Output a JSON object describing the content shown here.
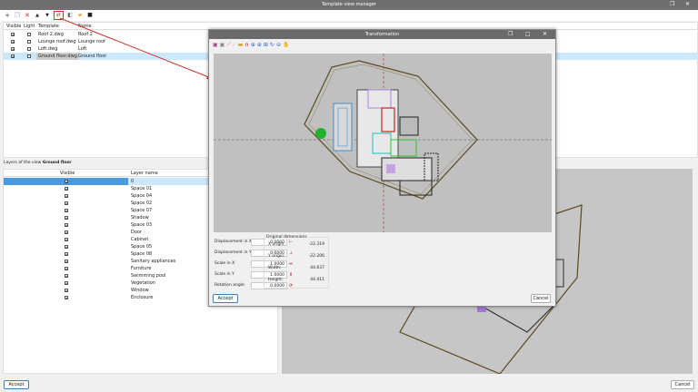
{
  "window": {
    "title": "Template view manager"
  },
  "toolbar": {
    "icons": [
      "add-icon",
      "copy-icon",
      "delete-icon",
      "move-up-icon",
      "move-down-icon",
      "transform-icon",
      "layers-icon",
      "open-folder-icon",
      "save-icon"
    ]
  },
  "templates": {
    "columns": [
      "Visible",
      "Light",
      "Template",
      "Name"
    ],
    "rows": [
      {
        "visible": true,
        "light": false,
        "template": "Roof 2.dwg",
        "name": "Roof 2"
      },
      {
        "visible": true,
        "light": false,
        "template": "Lounge roof.dwg",
        "name": "Lounge roof"
      },
      {
        "visible": true,
        "light": false,
        "template": "Loft.dwg",
        "name": "Loft"
      },
      {
        "visible": true,
        "light": false,
        "template": "Ground floor.dwg",
        "name": "Ground floor",
        "selected": true
      }
    ]
  },
  "layers": {
    "label": "Layers of the view",
    "view_name": "Ground floor",
    "columns": [
      "Visible",
      "Layer name"
    ],
    "rows": [
      "0",
      "Space 01",
      "Space 04",
      "Space 02",
      "Space 07",
      "Shadow",
      "Space 03",
      "Door",
      "Cabinet",
      "Space 05",
      "Space 08",
      "Sanitary appliances",
      "Furniture",
      "Swimming pool",
      "Vegetation",
      "Window",
      "Enclosure"
    ]
  },
  "footer": {
    "accept": "Accept",
    "cancel": "Cancel"
  },
  "dialog": {
    "title": "Transformation",
    "fields": [
      {
        "label": "Displacement in X",
        "value": "0.0000"
      },
      {
        "label": "Displacement in Y",
        "value": "0.0000"
      },
      {
        "label": "Scale in X",
        "value": "1.0000"
      },
      {
        "label": "Scale in Y",
        "value": "1.0000"
      },
      {
        "label": "Rotation angle",
        "value": "0.0000"
      }
    ],
    "original": {
      "title": "Original dimensions",
      "items": [
        {
          "label": "X origin:",
          "value": "-22.319"
        },
        {
          "label": "Y origin:",
          "value": "-22.206"
        },
        {
          "label": "Width:",
          "value": "44.637"
        },
        {
          "label": "Height:",
          "value": "44.411"
        }
      ]
    },
    "accept": "Accept",
    "cancel": "Cancel"
  },
  "colors": {
    "selection": "#cce8ff",
    "highlight": "#d0312d",
    "titlebar": "#6f6f6f"
  }
}
